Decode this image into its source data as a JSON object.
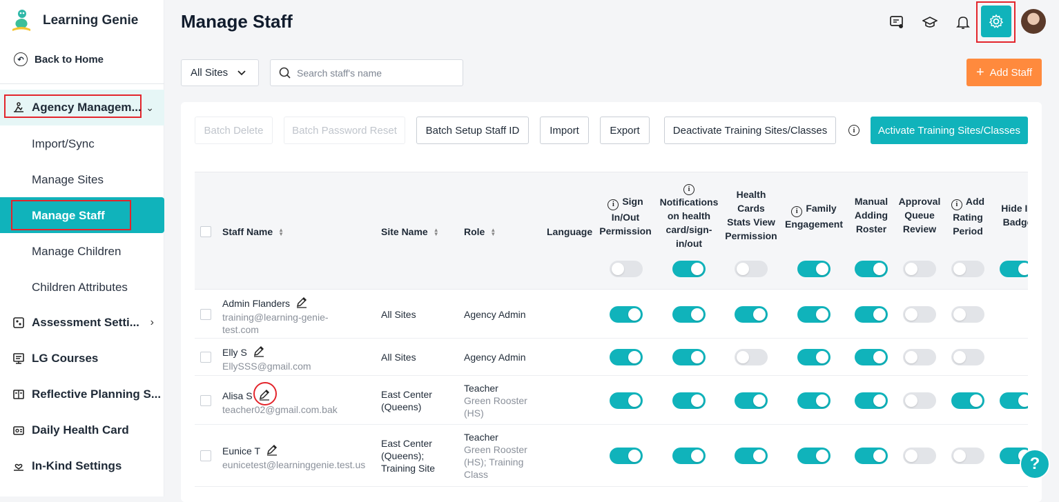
{
  "app": {
    "name": "Learning Genie"
  },
  "sidebar": {
    "back_label": "Back to Home",
    "group_label": "Agency Managem...",
    "sub_items": [
      "Import/Sync",
      "Manage Sites",
      "Manage Staff",
      "Manage Children",
      "Children Attributes"
    ],
    "items": [
      "Assessment Setti...",
      "LG Courses",
      "Reflective Planning S...",
      "Daily Health Card",
      "In-Kind Settings"
    ]
  },
  "header": {
    "title": "Manage Staff"
  },
  "filters": {
    "site_select": "All Sites",
    "search_placeholder": "Search staff's name",
    "add_staff_label": "Add Staff"
  },
  "toolbar": {
    "batch_delete": "Batch Delete",
    "batch_password_reset": "Batch Password Reset",
    "batch_setup_id": "Batch Setup Staff ID",
    "import": "Import",
    "export": "Export",
    "deactivate": "Deactivate Training Sites/Classes",
    "activate": "Activate Training Sites/Classes"
  },
  "table": {
    "columns": {
      "staff_name": "Staff Name",
      "site_name": "Site Name",
      "role": "Role",
      "language": "Language",
      "sign_a": "Sign",
      "sign_b": "In/Out",
      "sign_c": "Permission",
      "notif_1": "Notifications",
      "notif_2": "on health",
      "notif_3": "card/sign-",
      "notif_4": "in/out",
      "health_1": "Health",
      "health_2": "Cards",
      "health_3": "Stats View",
      "health_4": "Permission",
      "family_1": "Family",
      "family_2": "Engagement",
      "manual_1": "Manual",
      "manual_2": "Adding",
      "manual_3": "Roster",
      "approval_1": "Approval",
      "approval_2": "Queue",
      "approval_3": "Review",
      "rating_1": "Add",
      "rating_2": "Rating",
      "rating_3": "Period",
      "hide_1": "Hide IE",
      "hide_2": "Badge"
    },
    "header_toggles": [
      false,
      true,
      false,
      true,
      true,
      false,
      false,
      true
    ],
    "rows": [
      {
        "name": "Admin Flanders",
        "email_1": "training@learning-genie-",
        "email_2": "test.com",
        "site_1": "All Sites",
        "site_2": "",
        "site_3": "",
        "role": "Agency Admin",
        "class_1": "",
        "class_2": "",
        "class_3": "",
        "toggles": [
          true,
          true,
          true,
          true,
          true,
          false,
          false,
          null
        ]
      },
      {
        "name": "Elly S",
        "email_1": "EllySSS@gmail.com",
        "email_2": "",
        "site_1": "All Sites",
        "site_2": "",
        "site_3": "",
        "role": "Agency Admin",
        "class_1": "",
        "class_2": "",
        "class_3": "",
        "toggles": [
          true,
          true,
          false,
          true,
          true,
          false,
          false,
          null
        ]
      },
      {
        "name": "Alisa S",
        "email_1": "teacher02@gmail.com.bak",
        "email_2": "",
        "site_1": "East Center",
        "site_2": "(Queens)",
        "site_3": "",
        "role": "Teacher",
        "class_1": "Green Rooster",
        "class_2": "(HS)",
        "class_3": "",
        "toggles": [
          true,
          true,
          true,
          true,
          true,
          false,
          true,
          true
        ]
      },
      {
        "name": "Eunice T",
        "email_1": "eunicetest@learninggenie.test.us",
        "email_2": "",
        "site_1": "East Center",
        "site_2": "(Queens);",
        "site_3": "Training Site",
        "role": "Teacher",
        "class_1": "Green Rooster",
        "class_2": "(HS); Training",
        "class_3": "Class",
        "toggles": [
          true,
          true,
          true,
          true,
          true,
          false,
          false,
          true
        ]
      }
    ]
  },
  "help_label": "?"
}
